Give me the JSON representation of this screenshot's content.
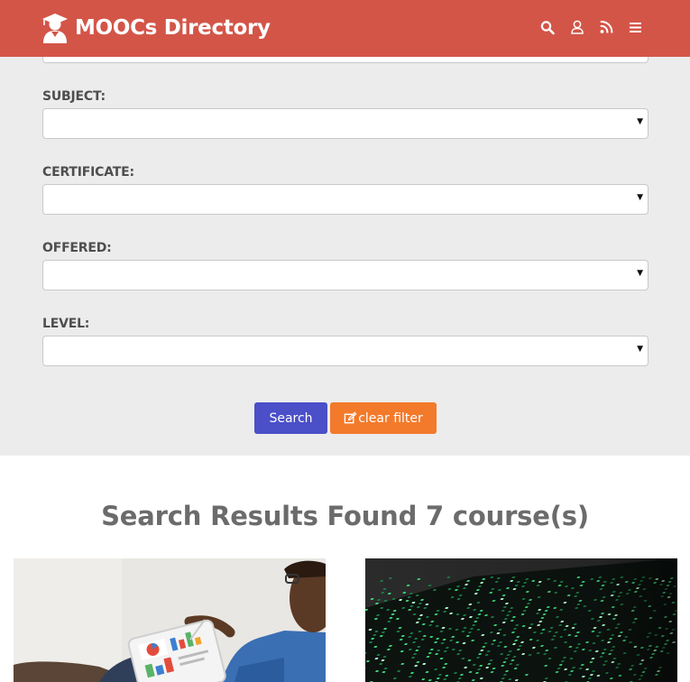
{
  "header": {
    "brand": "MOOCs Directory",
    "icons": [
      "search-icon",
      "user-icon",
      "rss-icon",
      "menu-icon"
    ],
    "color": "#d35548"
  },
  "filters": [
    {
      "label": "SUBJECT:",
      "value": ""
    },
    {
      "label": "CERTIFICATE:",
      "value": ""
    },
    {
      "label": "OFFERED:",
      "value": ""
    },
    {
      "label": "LEVEL:",
      "value": ""
    }
  ],
  "buttons": {
    "search": "Search",
    "clear": "clear filter",
    "search_color": "#4b4fc8",
    "clear_color": "#f37a2b"
  },
  "results": {
    "title": "Search Results Found 7 course(s)"
  },
  "cards": [
    {
      "image": "person-with-tablet-charts"
    },
    {
      "image": "green-code-screen"
    }
  ]
}
